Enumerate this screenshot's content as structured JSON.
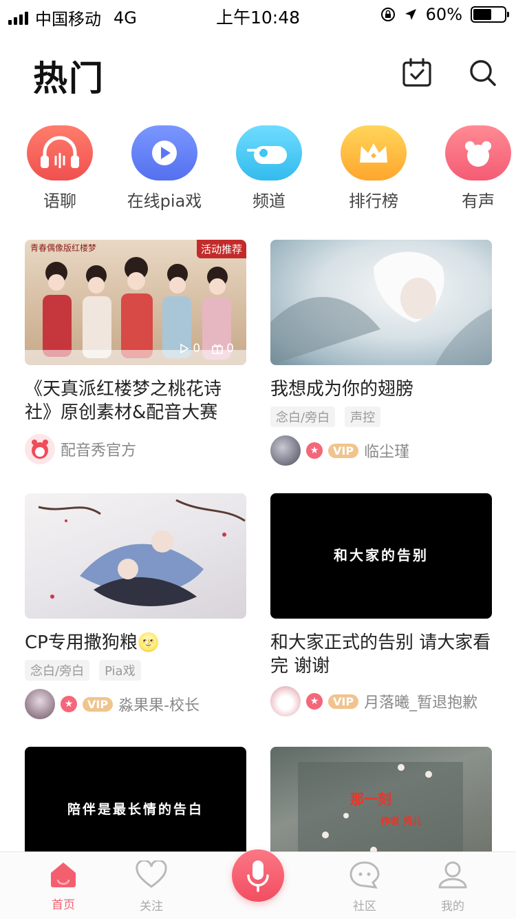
{
  "status_bar": {
    "carrier": "中国移动",
    "network": "4G",
    "time": "上午10:48",
    "battery": "60%",
    "battery_level": 0.6
  },
  "header": {
    "title": "热门"
  },
  "shortcuts": [
    {
      "label": "语聊",
      "icon": "headphones-icon",
      "color": "#f25f5c"
    },
    {
      "label": "在线pia戏",
      "icon": "play-icon",
      "color": "#5f7af5"
    },
    {
      "label": "频道",
      "icon": "channel-icon",
      "color": "#3fc6f0"
    },
    {
      "label": "排行榜",
      "icon": "crown-icon",
      "color": "#ffb341"
    },
    {
      "label": "有声",
      "icon": "bear-icon",
      "color": "#f46c80"
    }
  ],
  "cards": [
    {
      "title": "《天真派红楼梦之桃花诗社》原创素材&配音大赛",
      "overlay_tag": "活动推荐",
      "plays": "0",
      "gifts": "0",
      "tags": [],
      "author": "配音秀官方",
      "vip": false
    },
    {
      "title": "我想成为你的翅膀",
      "tags": [
        "念白/旁白",
        "声控"
      ],
      "author": "临尘瑾",
      "vip": true,
      "vip_label": "VIP"
    },
    {
      "title": "CP专用撒狗粮🌝",
      "tags": [
        "念白/旁白",
        "Pia戏"
      ],
      "author": "淼果果-校长",
      "vip": true,
      "vip_label": "VIP"
    },
    {
      "title": "和大家正式的告别 请大家看完 谢谢",
      "thumb_text": "和大家的告别",
      "tags": [],
      "author": "月落曦_暂退抱歉",
      "vip": true,
      "vip_label": "VIP"
    },
    {
      "title": "",
      "thumb_text": "陪伴是最长情的告白",
      "tags": [],
      "author": ""
    },
    {
      "title": "",
      "thumb_text": "那一刻",
      "thumb_subtext": "作者 秀儿",
      "tags": [],
      "author": ""
    }
  ],
  "tabbar": {
    "tabs": [
      {
        "label": "首页",
        "icon": "home-icon",
        "active": true
      },
      {
        "label": "关注",
        "icon": "heart-icon",
        "active": false
      },
      {
        "label": "",
        "icon": "microphone-icon"
      },
      {
        "label": "社区",
        "icon": "community-icon",
        "active": false
      },
      {
        "label": "我的",
        "icon": "profile-icon",
        "active": false
      }
    ]
  },
  "colors": {
    "accent": "#f45f6f",
    "vip": "#f0c48c"
  }
}
